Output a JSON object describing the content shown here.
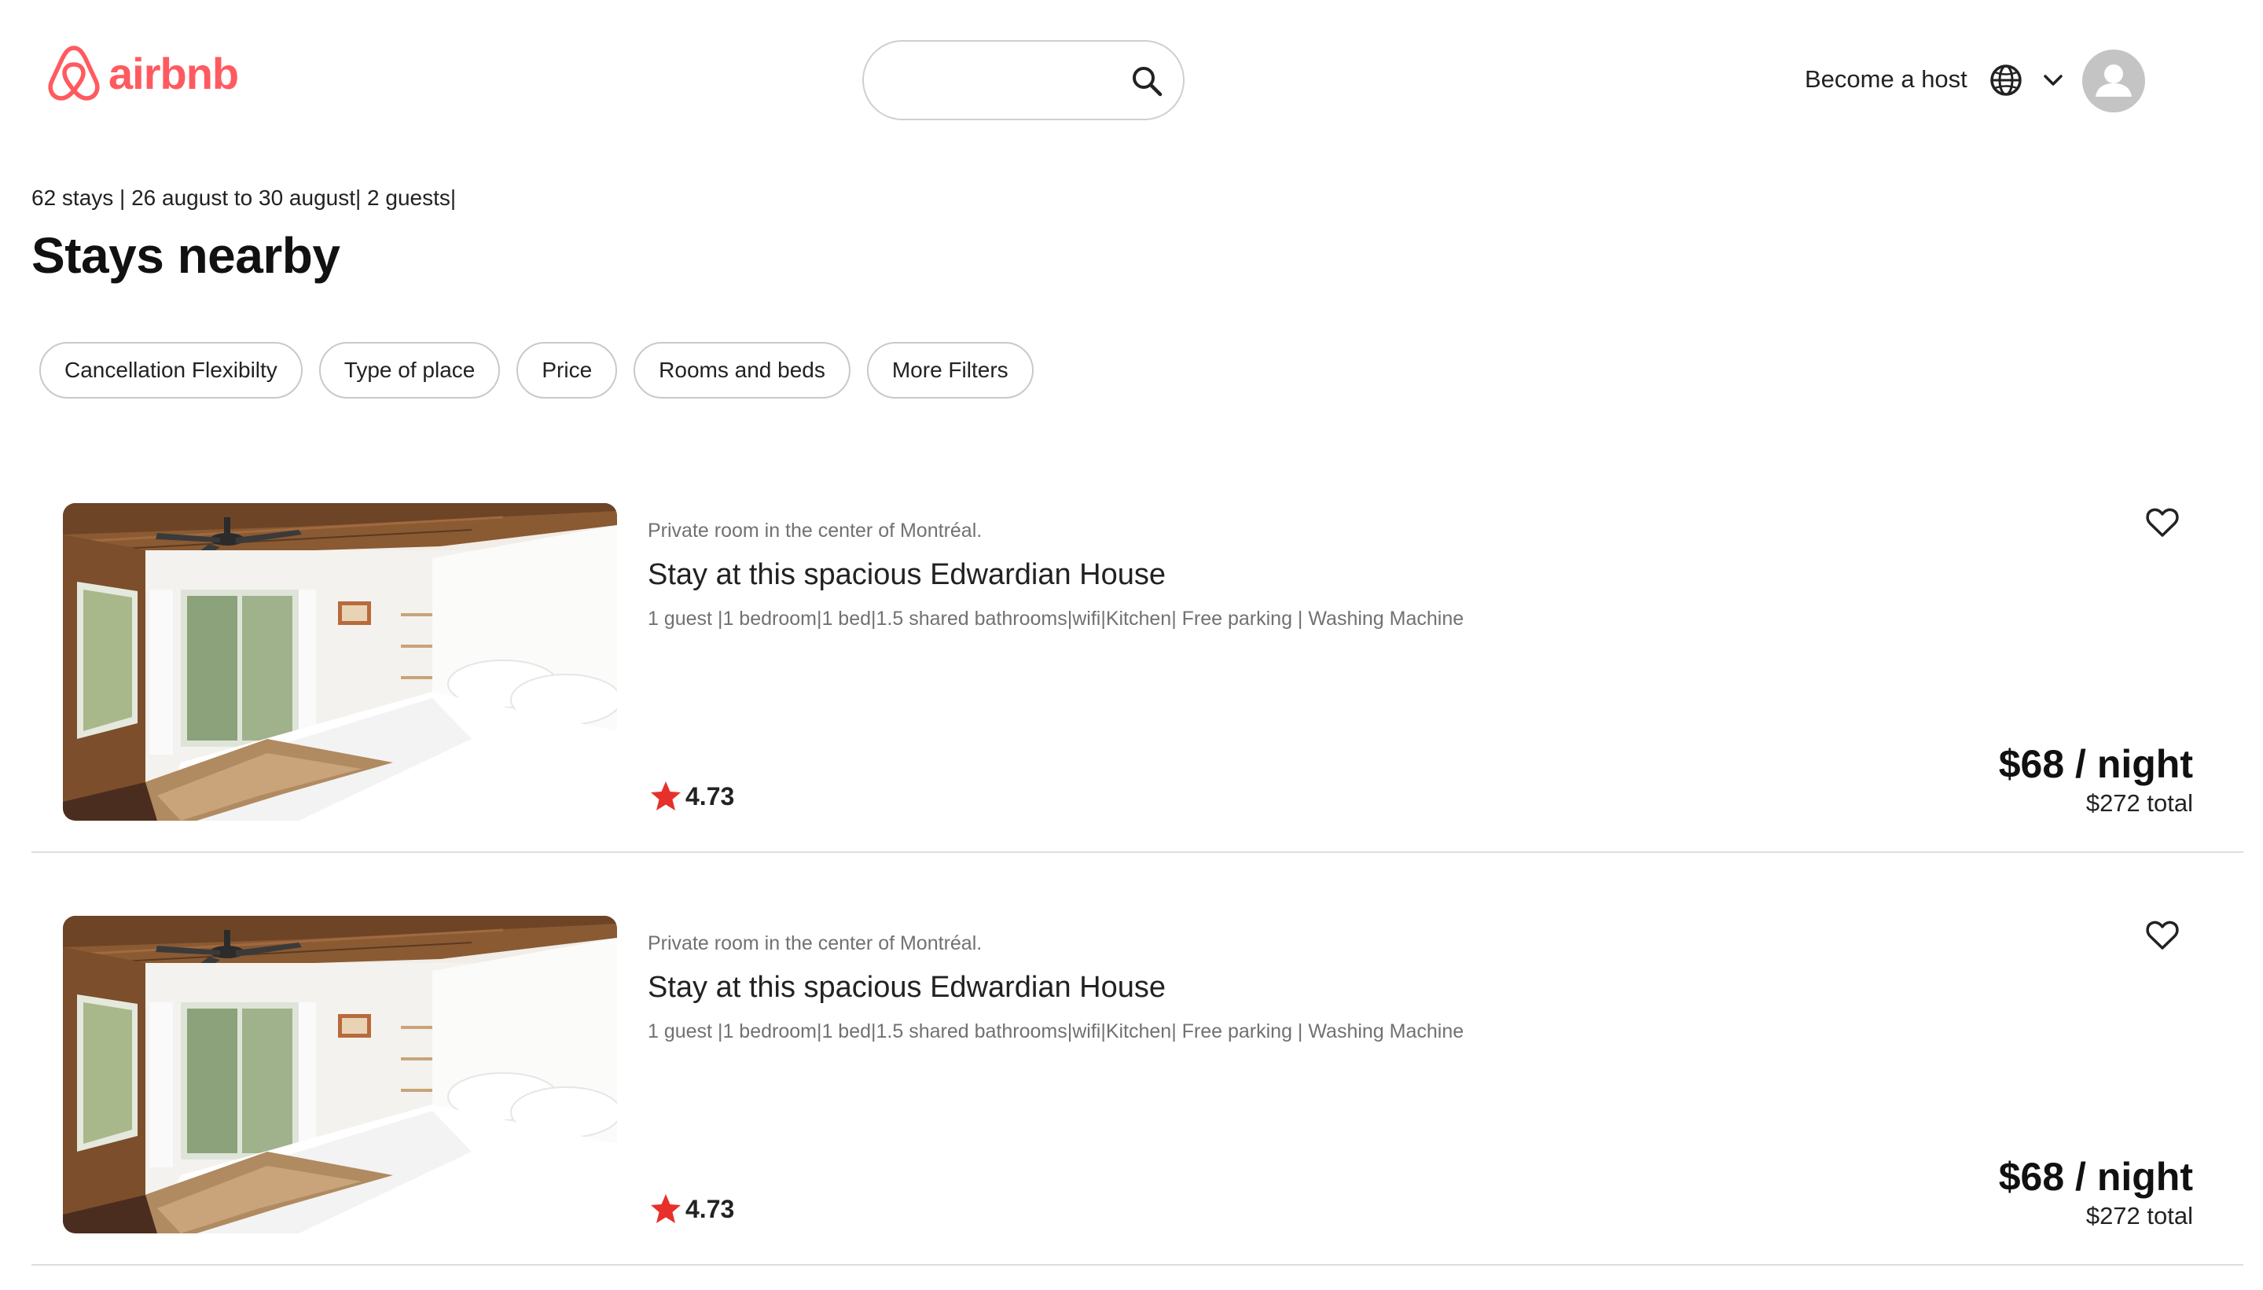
{
  "header": {
    "logo_text": "airbnb",
    "search": {
      "value": "",
      "placeholder": ""
    },
    "host_link": "Become a host",
    "icons": {
      "logo": "airbnb-belo-icon",
      "search": "search-icon",
      "globe": "globe-icon",
      "menu": "chevron-down-icon",
      "avatar": "user-icon"
    }
  },
  "summary": {
    "text": "62 stays | 26 august to 30 august| 2 guests|",
    "title": "Stays nearby"
  },
  "filters": [
    "Cancellation Flexibilty",
    "Type of place",
    "Price",
    "Rooms and beds",
    "More Filters"
  ],
  "listings": [
    {
      "subtitle": "Private room in the center of Montréal.",
      "title": "Stay at this spacious Edwardian House",
      "amenities": "1 guest |1 bedroom|1 bed|1.5 shared bathrooms|wifi|Kitchen| Free parking | Washing Machine",
      "rating": "4.73",
      "price_night": "$68 / night",
      "price_total": "$272 total"
    },
    {
      "subtitle": "Private room in the center of Montréal.",
      "title": "Stay at this spacious Edwardian House",
      "amenities": "1 guest |1 bedroom|1 bed|1.5 shared bathrooms|wifi|Kitchen| Free parking | Washing Machine",
      "rating": "4.73",
      "price_night": "$68 / night",
      "price_total": "$272 total"
    }
  ],
  "colors": {
    "brand": "#FF5A5F",
    "star": "#E8302B",
    "text": "#222222",
    "muted": "#717171",
    "border": "#C9C9C9",
    "divider": "#DDDDDD",
    "avatar_bg": "#C4C4C4"
  }
}
